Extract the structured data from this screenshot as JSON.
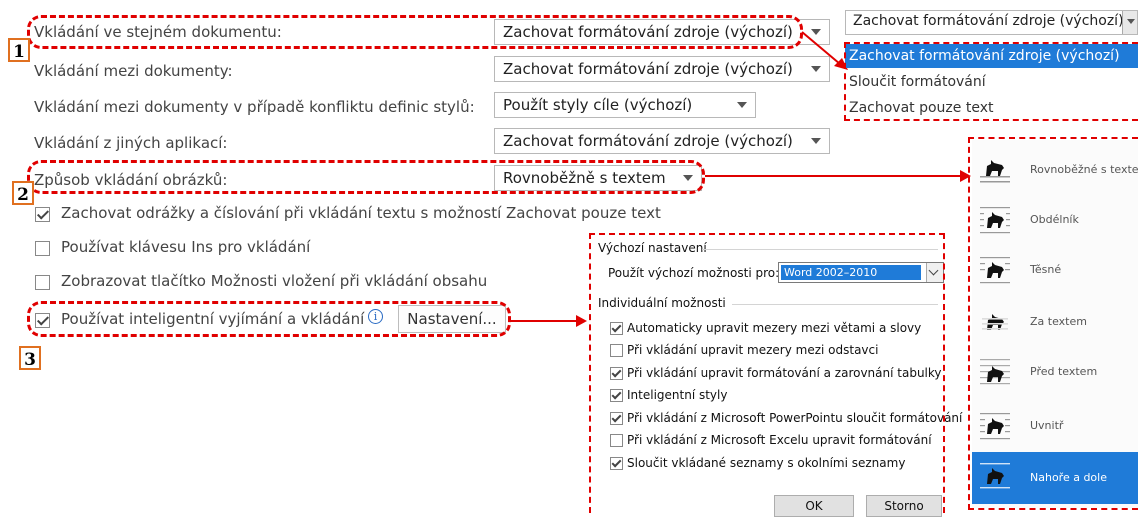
{
  "options": {
    "rows": [
      {
        "label": "Vkládání ve stejném dokumentu:",
        "value": "Zachovat formátování zdroje (výchozí)"
      },
      {
        "label": "Vkládání mezi dokumenty:",
        "value": "Zachovat formátování zdroje (výchozí)"
      },
      {
        "label": "Vkládání mezi dokumenty v případě konfliktu definic stylů:",
        "value": "Použít styly cíle (výchozí)"
      },
      {
        "label": "Vkládání z jiných aplikací:",
        "value": "Zachovat formátování zdroje (výchozí)"
      },
      {
        "label": "Způsob vkládání obrázků:",
        "value": "Rovnoběžně s textem"
      }
    ],
    "checkboxes": [
      {
        "label": "Zachovat odrážky a číslování při vkládání textu s možností Zachovat pouze text",
        "checked": true
      },
      {
        "label": "Používat klávesu Ins pro vkládání",
        "checked": false
      },
      {
        "label": "Zobrazovat tlačítko Možnosti vložení při vkládání obsahu",
        "checked": false
      },
      {
        "label": "Používat inteligentní vyjímání a vkládání",
        "checked": true
      }
    ],
    "info_icon": "info-icon",
    "settings_button": "Nastavení..."
  },
  "markers": [
    "1",
    "2",
    "3"
  ],
  "paste_dropdown": {
    "selected": "Zachovat formátování zdroje (výchozí)",
    "items": [
      "Zachovat formátování zdroje (výchozí)",
      "Sloučit formátování",
      "Zachovat pouze text"
    ],
    "highlight_color": "#1f7bd8"
  },
  "settings_dialog": {
    "section_default": "Výchozí nastavení",
    "use_defaults_label": "Použít výchozí možnosti pro:",
    "use_defaults_value": "Word 2002–2010",
    "section_individual": "Individuální možnosti",
    "options": [
      {
        "label": "Automaticky upravit mezery mezi větami a slovy",
        "checked": true
      },
      {
        "label": "Při vkládání upravit mezery mezi odstavci",
        "checked": false
      },
      {
        "label": "Při vkládání upravit formátování a zarovnání tabulky",
        "checked": true
      },
      {
        "label": "Inteligentní styly",
        "checked": true
      },
      {
        "label": "Při vkládání z Microsoft PowerPointu sloučit formátování",
        "checked": true
      },
      {
        "label": "Při vkládání z Microsoft Excelu upravit formátování",
        "checked": false
      },
      {
        "label": "Sloučit vkládané seznamy s okolními seznamy",
        "checked": true
      }
    ],
    "ok": "OK",
    "cancel": "Storno"
  },
  "wrap_panel": {
    "items": [
      {
        "label": "Rovnoběžné s textem",
        "icon": "wrap-inline-icon"
      },
      {
        "label": "Obdélník",
        "icon": "wrap-square-icon"
      },
      {
        "label": "Těsné",
        "icon": "wrap-tight-icon"
      },
      {
        "label": "Za textem",
        "icon": "wrap-behind-icon"
      },
      {
        "label": "Před textem",
        "icon": "wrap-front-icon"
      },
      {
        "label": "Uvnitř",
        "icon": "wrap-through-icon"
      },
      {
        "label": "Nahoře a dole",
        "icon": "wrap-topbottom-icon",
        "selected": true
      }
    ],
    "selected_color": "#1f7bd8"
  }
}
